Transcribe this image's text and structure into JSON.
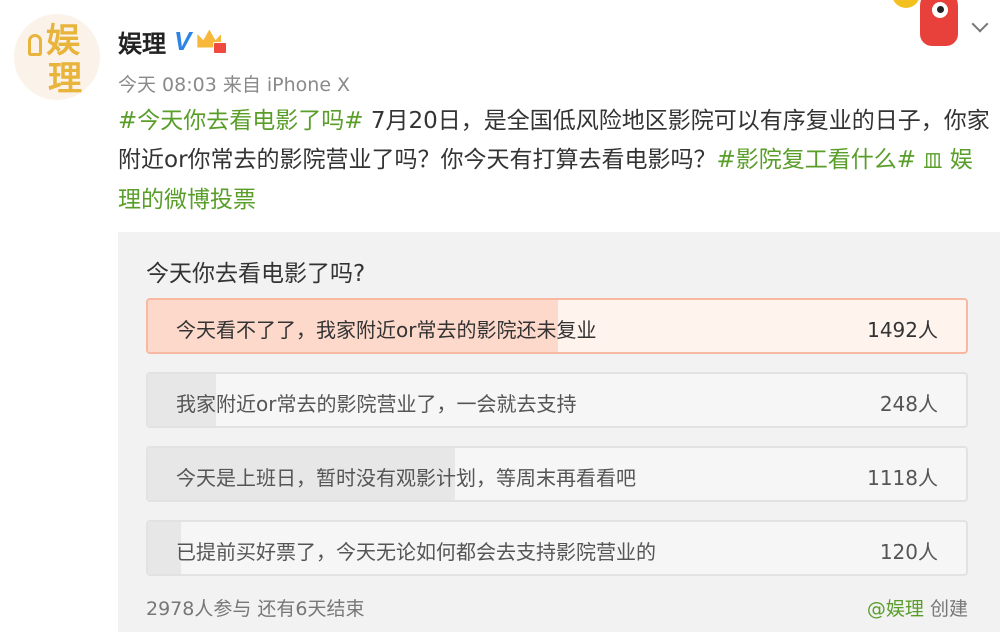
{
  "account": {
    "avatar_text_1": "娱",
    "avatar_text_2": "理",
    "username": "娱理",
    "verified_glyph": "V",
    "time": "今天 08:03",
    "source": "来自 iPhone X"
  },
  "post": {
    "topic1": "#今天你去看电影了吗#",
    "text1": " 7月20日，是全国低风险地区影院可以有序复业的日子，你家附近or你常去的影院营业了吗？你今天有打算去看电影吗？",
    "topic2": "#影院复工看什么#",
    "link_icon": "皿",
    "link_text": "娱理的微博投票"
  },
  "poll": {
    "question": "今天你去看电影了吗?",
    "options": [
      {
        "label": "今天看不了了，我家附近or常去的影院还未复业",
        "count": "1492人",
        "share": 0.501
      },
      {
        "label": "我家附近or常去的影院营业了，一会就去支持",
        "count": "248人",
        "share": 0.083
      },
      {
        "label": "今天是上班日，暂时没有观影计划，等周末再看看吧",
        "count": "1118人",
        "share": 0.375
      },
      {
        "label": "已提前买好票了，今天无论如何都会去支持影院营业的",
        "count": "120人",
        "share": 0.04
      }
    ],
    "participants": "2978人参与",
    "remaining": "还有6天结束",
    "creator": "@娱理",
    "created_label": "创建"
  },
  "colors": {
    "accent_green": "#5a9e2a",
    "selected_fill": "#fcd9cb",
    "selected_border": "#f9b8a2"
  }
}
